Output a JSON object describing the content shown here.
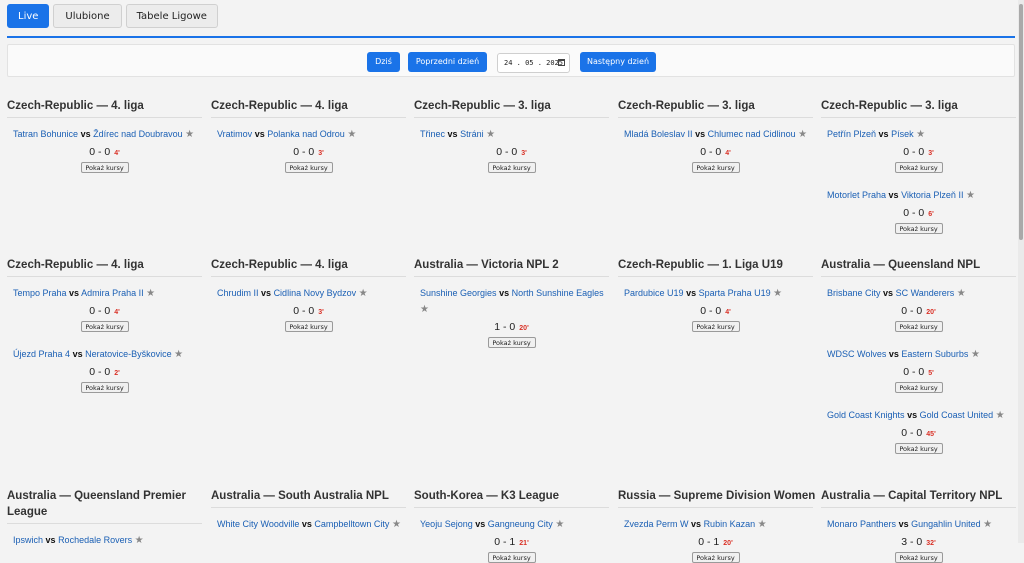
{
  "tabs": {
    "live": "Live",
    "favorites": "Ulubione",
    "tables": "Tabele Ligowe"
  },
  "toolbar": {
    "today": "Dziś",
    "prev": "Poprzedni dzień",
    "date": "24 . 05 . 2025",
    "next": "Następny dzień"
  },
  "odds_label": "Pokaż kursy",
  "vs": "vs",
  "star": "★",
  "colors": {
    "accent": "#1a73e8",
    "team_link": "#1a5fb4",
    "minute": "#d93025"
  },
  "blocks": [
    {
      "title": "Czech-Republic — 4. liga",
      "matches": [
        {
          "home": "Tatran Bohunice",
          "away": "Ždírec nad Doubravou",
          "score": "0 - 0",
          "minute": "4'"
        }
      ]
    },
    {
      "title": "Czech-Republic — 4. liga",
      "matches": [
        {
          "home": "Vratimov",
          "away": "Polanka nad Odrou",
          "score": "0 - 0",
          "minute": "3'"
        }
      ]
    },
    {
      "title": "Czech-Republic — 3. liga",
      "matches": [
        {
          "home": "Třinec",
          "away": "Stráni",
          "score": "0 - 0",
          "minute": "3'"
        }
      ]
    },
    {
      "title": "Czech-Republic — 3. liga",
      "matches": [
        {
          "home": "Mladá Boleslav II",
          "away": "Chlumec nad Cidlinou",
          "score": "0 - 0",
          "minute": "4'"
        }
      ]
    },
    {
      "title": "Czech-Republic — 3. liga",
      "matches": [
        {
          "home": "Petřín Plzeň",
          "away": "Písek",
          "score": "0 - 0",
          "minute": "3'"
        },
        {
          "home": "Motorlet Praha",
          "away": "Viktoria Plzeň II",
          "score": "0 - 0",
          "minute": "6'"
        }
      ]
    },
    {
      "title": "Czech-Republic — 4. liga",
      "matches": [
        {
          "home": "Tempo Praha",
          "away": "Admira Praha II",
          "score": "0 - 0",
          "minute": "4'"
        },
        {
          "home": "Újezd Praha 4",
          "away": "Neratovice-Byškovice",
          "score": "0 - 0",
          "minute": "2'"
        }
      ]
    },
    {
      "title": "Czech-Republic — 4. liga",
      "matches": [
        {
          "home": "Chrudim II",
          "away": "Cidlina Novy Bydzov",
          "score": "0 - 0",
          "minute": "3'"
        }
      ]
    },
    {
      "title": "Australia — Victoria NPL 2",
      "matches": [
        {
          "home": "Sunshine Georgies",
          "away": "North Sunshine Eagles",
          "score": "1 - 0",
          "minute": "20'"
        }
      ]
    },
    {
      "title": "Czech-Republic — 1. Liga U19",
      "matches": [
        {
          "home": "Pardubice U19",
          "away": "Sparta Praha U19",
          "score": "0 - 0",
          "minute": "4'"
        }
      ]
    },
    {
      "title": "Australia — Queensland NPL",
      "matches": [
        {
          "home": "Brisbane City",
          "away": "SC Wanderers",
          "score": "0 - 0",
          "minute": "20'"
        },
        {
          "home": "WDSC Wolves",
          "away": "Eastern Suburbs",
          "score": "0 - 0",
          "minute": "5'"
        },
        {
          "home": "Gold Coast Knights",
          "away": "Gold Coast United",
          "score": "0 - 0",
          "minute": "45'"
        }
      ]
    },
    {
      "title": "Australia — Queensland Premier League",
      "matches": [
        {
          "home": "Ipswich",
          "away": "Rochedale Rovers",
          "score": "",
          "minute": ""
        }
      ]
    },
    {
      "title": "Australia — South Australia NPL",
      "matches": [
        {
          "home": "White City Woodville",
          "away": "Campbelltown City",
          "score": "",
          "minute": ""
        }
      ]
    },
    {
      "title": "South-Korea — K3 League",
      "matches": [
        {
          "home": "Yeoju Sejong",
          "away": "Gangneung City",
          "score": "0 - 1",
          "minute": "21'"
        }
      ]
    },
    {
      "title": "Russia — Supreme Division Women",
      "matches": [
        {
          "home": "Zvezda Perm W",
          "away": "Rubin Kazan",
          "score": "0 - 1",
          "minute": "20'"
        }
      ]
    },
    {
      "title": "Australia — Capital Territory NPL",
      "matches": [
        {
          "home": "Monaro Panthers",
          "away": "Gungahlin United",
          "score": "3 - 0",
          "minute": "32'"
        }
      ]
    }
  ]
}
